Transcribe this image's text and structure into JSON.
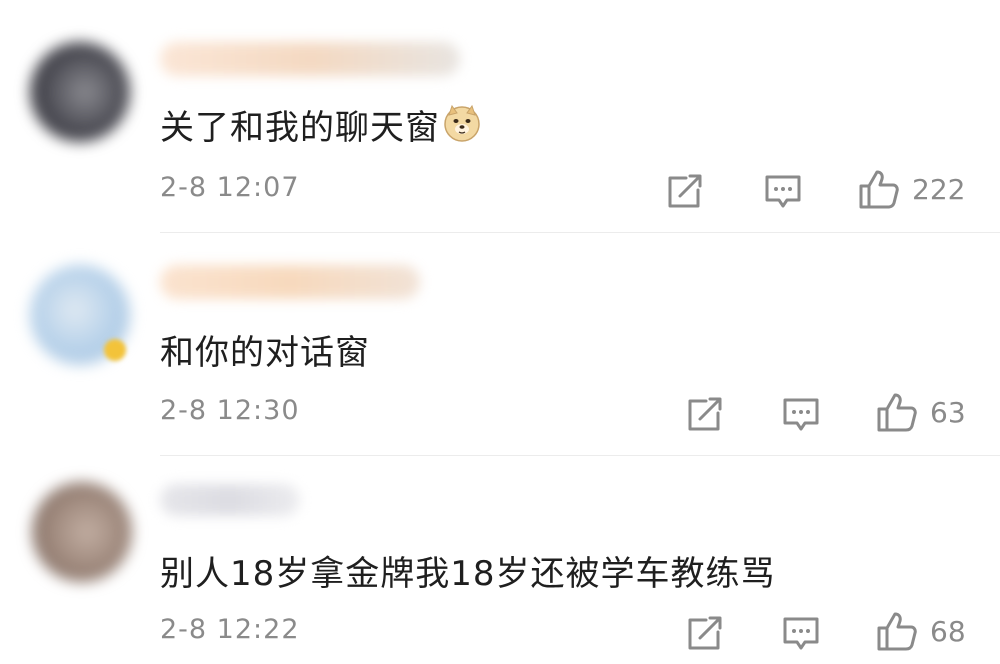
{
  "comments": [
    {
      "text": "关了和我的聊天窗",
      "emoji": "doge-emoji",
      "time": "2-8 12:07",
      "likes": "222",
      "avatar_color": "#4a4a52",
      "username_blurred": true
    },
    {
      "text": "和你的对话窗",
      "time": "2-8 12:30",
      "likes": "63",
      "avatar_color": "#b8d2ea",
      "username_blurred": true
    },
    {
      "text": "别人18岁拿金牌我18岁还被学车教练骂",
      "time": "2-8 12:22",
      "likes": "68",
      "avatar_color": "#9a8478",
      "username_blurred": true
    }
  ],
  "icons": {
    "share": "share-icon",
    "reply": "comment-icon",
    "like": "thumbs-up-icon"
  },
  "colors": {
    "text": "#1f1f1f",
    "meta": "#8a8a8a",
    "icon": "#8a8a8a"
  }
}
